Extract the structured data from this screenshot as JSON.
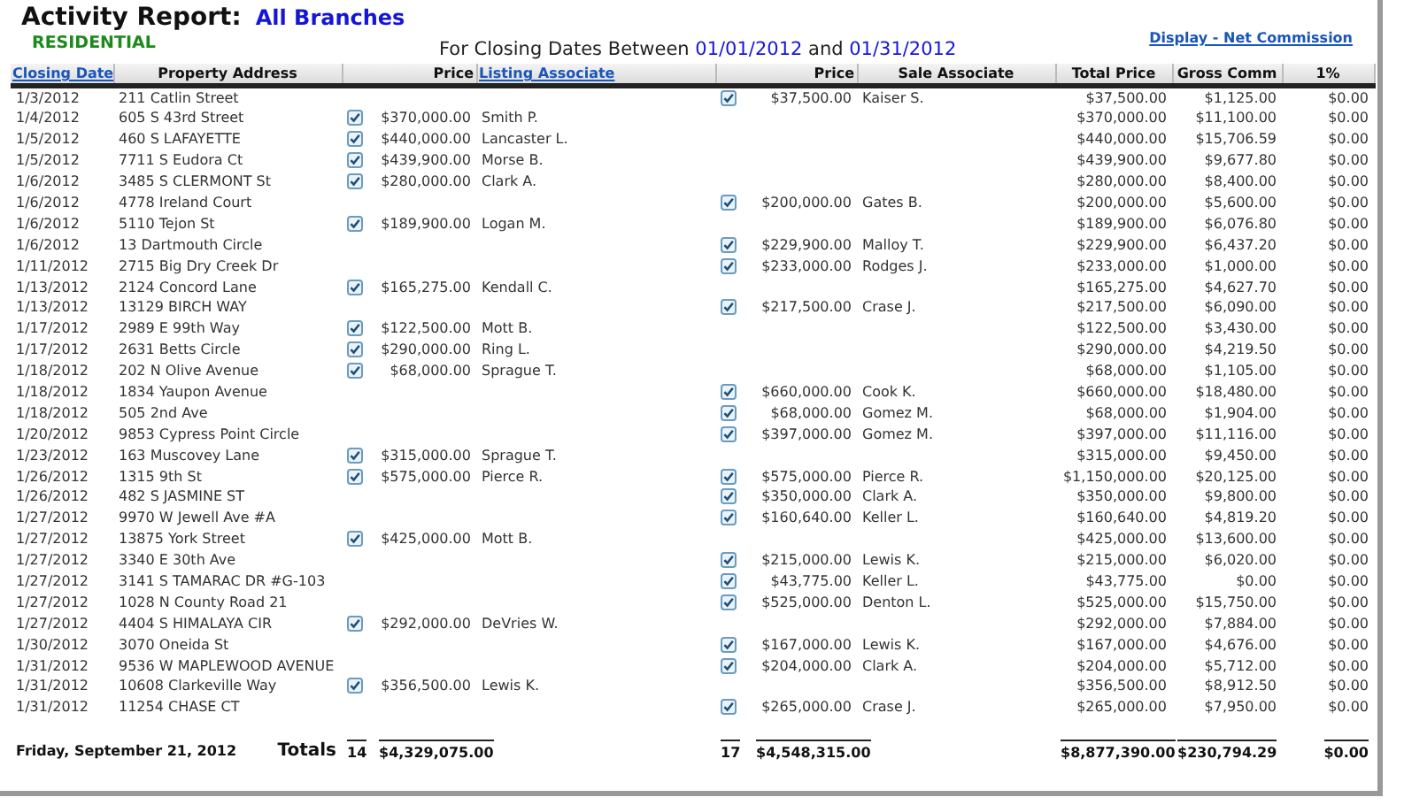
{
  "report": {
    "title": "Activity Report:",
    "branch": "All Branches",
    "category": "RESIDENTIAL",
    "range": {
      "prefix": "For Closing Dates Between",
      "start": "01/01/2012",
      "joiner": "and",
      "end": "01/31/2012"
    },
    "display_link": "Display - Net Commission"
  },
  "table": {
    "columns": [
      {
        "label": "Closing Date",
        "kind": "link"
      },
      {
        "label": "Property Address",
        "kind": "text"
      },
      {
        "label": "Price",
        "kind": "text"
      },
      {
        "label": "Listing Associate",
        "kind": "link"
      },
      {
        "label": "Price",
        "kind": "text"
      },
      {
        "label": "Sale Associate",
        "kind": "text"
      },
      {
        "label": "Total Price",
        "kind": "text"
      },
      {
        "label": "Gross Comm",
        "kind": "text"
      },
      {
        "label": "1%",
        "kind": "text"
      }
    ],
    "rows": [
      {
        "date": "1/3/2012",
        "address": "211 Catlin Street",
        "sale": {
          "checked": true,
          "price": "$37,500.00",
          "associate": "Kaiser S."
        },
        "total": "$37,500.00",
        "gross": "$1,125.00",
        "pct": "$0.00"
      },
      {
        "date": "1/4/2012",
        "address": "605 S 43rd Street",
        "listing": {
          "checked": true,
          "price": "$370,000.00",
          "associate": "Smith P."
        },
        "total": "$370,000.00",
        "gross": "$11,100.00",
        "pct": "$0.00"
      },
      {
        "date": "1/5/2012",
        "address": "460 S LAFAYETTE",
        "listing": {
          "checked": true,
          "price": "$440,000.00",
          "associate": "Lancaster L."
        },
        "total": "$440,000.00",
        "gross": "$15,706.59",
        "pct": "$0.00"
      },
      {
        "date": "1/5/2012",
        "address": "7711 S Eudora Ct",
        "listing": {
          "checked": true,
          "price": "$439,900.00",
          "associate": "Morse B."
        },
        "total": "$439,900.00",
        "gross": "$9,677.80",
        "pct": "$0.00"
      },
      {
        "date": "1/6/2012",
        "address": "3485 S CLERMONT St",
        "listing": {
          "checked": true,
          "price": "$280,000.00",
          "associate": "Clark A."
        },
        "total": "$280,000.00",
        "gross": "$8,400.00",
        "pct": "$0.00"
      },
      {
        "date": "1/6/2012",
        "address": "4778 Ireland Court",
        "sale": {
          "checked": true,
          "price": "$200,000.00",
          "associate": "Gates B."
        },
        "total": "$200,000.00",
        "gross": "$5,600.00",
        "pct": "$0.00"
      },
      {
        "date": "1/6/2012",
        "address": "5110 Tejon St",
        "listing": {
          "checked": true,
          "price": "$189,900.00",
          "associate": "Logan M."
        },
        "total": "$189,900.00",
        "gross": "$6,076.80",
        "pct": "$0.00"
      },
      {
        "date": "1/6/2012",
        "address": "13 Dartmouth Circle",
        "sale": {
          "checked": true,
          "price": "$229,900.00",
          "associate": "Malloy T."
        },
        "total": "$229,900.00",
        "gross": "$6,437.20",
        "pct": "$0.00"
      },
      {
        "date": "1/11/2012",
        "address": "2715 Big Dry Creek Dr",
        "sale": {
          "checked": true,
          "price": "$233,000.00",
          "associate": "Rodges J."
        },
        "total": "$233,000.00",
        "gross": "$1,000.00",
        "pct": "$0.00"
      },
      {
        "date": "1/13/2012",
        "address": "2124 Concord Lane",
        "listing": {
          "checked": true,
          "price": "$165,275.00",
          "associate": "Kendall C."
        },
        "total": "$165,275.00",
        "gross": "$4,627.70",
        "pct": "$0.00"
      },
      {
        "date": "1/13/2012",
        "address": "13129 BIRCH WAY",
        "sale": {
          "checked": true,
          "price": "$217,500.00",
          "associate": "Crase J."
        },
        "total": "$217,500.00",
        "gross": "$6,090.00",
        "pct": "$0.00"
      },
      {
        "date": "1/17/2012",
        "address": "2989 E 99th Way",
        "listing": {
          "checked": true,
          "price": "$122,500.00",
          "associate": "Mott B."
        },
        "total": "$122,500.00",
        "gross": "$3,430.00",
        "pct": "$0.00"
      },
      {
        "date": "1/17/2012",
        "address": "2631 Betts Circle",
        "listing": {
          "checked": true,
          "price": "$290,000.00",
          "associate": "Ring L."
        },
        "total": "$290,000.00",
        "gross": "$4,219.50",
        "pct": "$0.00"
      },
      {
        "date": "1/18/2012",
        "address": "202 N Olive Avenue",
        "listing": {
          "checked": true,
          "price": "$68,000.00",
          "associate": "Sprague T."
        },
        "total": "$68,000.00",
        "gross": "$1,105.00",
        "pct": "$0.00"
      },
      {
        "date": "1/18/2012",
        "address": "1834 Yaupon Avenue",
        "sale": {
          "checked": true,
          "price": "$660,000.00",
          "associate": "Cook K."
        },
        "total": "$660,000.00",
        "gross": "$18,480.00",
        "pct": "$0.00"
      },
      {
        "date": "1/18/2012",
        "address": "505 2nd Ave",
        "sale": {
          "checked": true,
          "price": "$68,000.00",
          "associate": "Gomez M."
        },
        "total": "$68,000.00",
        "gross": "$1,904.00",
        "pct": "$0.00"
      },
      {
        "date": "1/20/2012",
        "address": "9853 Cypress Point Circle",
        "sale": {
          "checked": true,
          "price": "$397,000.00",
          "associate": "Gomez M."
        },
        "total": "$397,000.00",
        "gross": "$11,116.00",
        "pct": "$0.00"
      },
      {
        "date": "1/23/2012",
        "address": "163 Muscovey Lane",
        "listing": {
          "checked": true,
          "price": "$315,000.00",
          "associate": "Sprague T."
        },
        "total": "$315,000.00",
        "gross": "$9,450.00",
        "pct": "$0.00"
      },
      {
        "date": "1/26/2012",
        "address": "1315 9th St",
        "listing": {
          "checked": true,
          "price": "$575,000.00",
          "associate": "Pierce R."
        },
        "sale": {
          "checked": true,
          "price": "$575,000.00",
          "associate": "Pierce R."
        },
        "total": "$1,150,000.00",
        "gross": "$20,125.00",
        "pct": "$0.00"
      },
      {
        "date": "1/26/2012",
        "address": "482 S JASMINE ST",
        "sale": {
          "checked": true,
          "price": "$350,000.00",
          "associate": "Clark A."
        },
        "total": "$350,000.00",
        "gross": "$9,800.00",
        "pct": "$0.00"
      },
      {
        "date": "1/27/2012",
        "address": "9970 W Jewell Ave #A",
        "sale": {
          "checked": true,
          "price": "$160,640.00",
          "associate": "Keller L."
        },
        "total": "$160,640.00",
        "gross": "$4,819.20",
        "pct": "$0.00"
      },
      {
        "date": "1/27/2012",
        "address": "13875 York Street",
        "listing": {
          "checked": true,
          "price": "$425,000.00",
          "associate": "Mott B."
        },
        "total": "$425,000.00",
        "gross": "$13,600.00",
        "pct": "$0.00"
      },
      {
        "date": "1/27/2012",
        "address": "3340 E 30th Ave",
        "sale": {
          "checked": true,
          "price": "$215,000.00",
          "associate": "Lewis K."
        },
        "total": "$215,000.00",
        "gross": "$6,020.00",
        "pct": "$0.00"
      },
      {
        "date": "1/27/2012",
        "address": "3141 S TAMARAC DR #G-103",
        "sale": {
          "checked": true,
          "price": "$43,775.00",
          "associate": "Keller L."
        },
        "total": "$43,775.00",
        "gross": "$0.00",
        "pct": "$0.00"
      },
      {
        "date": "1/27/2012",
        "address": "1028 N County Road 21",
        "sale": {
          "checked": true,
          "price": "$525,000.00",
          "associate": "Denton L."
        },
        "total": "$525,000.00",
        "gross": "$15,750.00",
        "pct": "$0.00"
      },
      {
        "date": "1/27/2012",
        "address": "4404 S HIMALAYA CIR",
        "listing": {
          "checked": true,
          "price": "$292,000.00",
          "associate": "DeVries W."
        },
        "total": "$292,000.00",
        "gross": "$7,884.00",
        "pct": "$0.00"
      },
      {
        "date": "1/30/2012",
        "address": "3070 Oneida St",
        "sale": {
          "checked": true,
          "price": "$167,000.00",
          "associate": "Lewis K."
        },
        "total": "$167,000.00",
        "gross": "$4,676.00",
        "pct": "$0.00"
      },
      {
        "date": "1/31/2012",
        "address": "9536 W MAPLEWOOD AVENUE",
        "sale": {
          "checked": true,
          "price": "$204,000.00",
          "associate": "Clark A."
        },
        "total": "$204,000.00",
        "gross": "$5,712.00",
        "pct": "$0.00"
      },
      {
        "date": "1/31/2012",
        "address": "10608 Clarkeville Way",
        "listing": {
          "checked": true,
          "price": "$356,500.00",
          "associate": "Lewis K."
        },
        "total": "$356,500.00",
        "gross": "$8,912.50",
        "pct": "$0.00"
      },
      {
        "date": "1/31/2012",
        "address": "11254 CHASE CT",
        "sale": {
          "checked": true,
          "price": "$265,000.00",
          "associate": "Crase J."
        },
        "total": "$265,000.00",
        "gross": "$7,950.00",
        "pct": "$0.00"
      }
    ],
    "footer": {
      "date": "Friday, September 21, 2012",
      "label": "Totals",
      "listing_count": "14",
      "listing_total": "$4,329,075.00",
      "sale_count": "17",
      "sale_total": "$4,548,315.00",
      "total_price": "$8,877,390.00",
      "gross": "$230,794.29",
      "pct": "$0.00"
    }
  }
}
